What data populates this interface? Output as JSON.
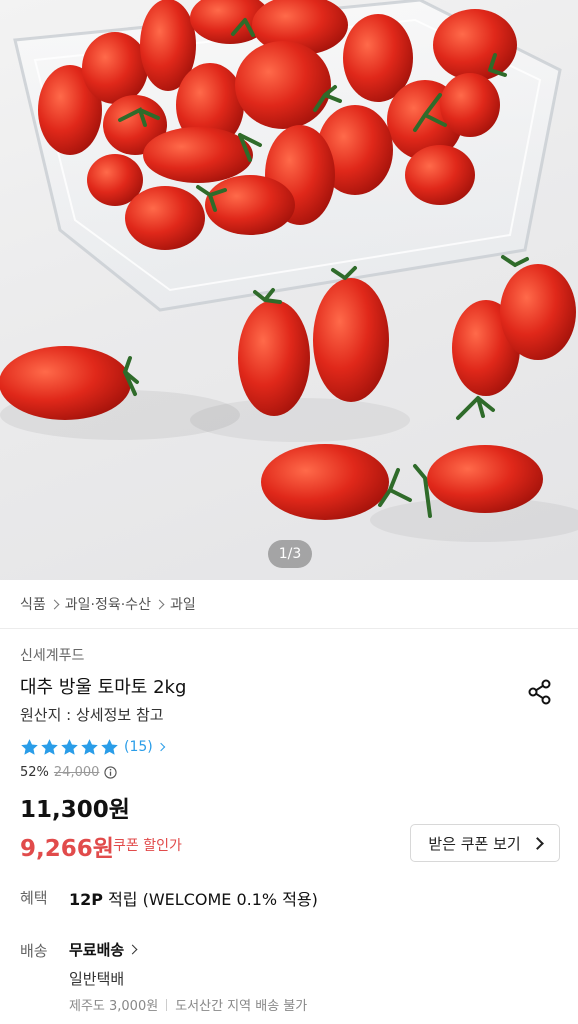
{
  "gallery": {
    "indicator": "1/3"
  },
  "breadcrumb": [
    "식품",
    "과일·정육·수산",
    "과일"
  ],
  "product": {
    "brand": "신세계푸드",
    "title": "대추 방울 토마토 2kg",
    "origin": "원산지 : 상세정보 참고",
    "rating": {
      "stars": 5,
      "review_count": "(15)"
    },
    "discount_rate": "52%",
    "original_price": "24,000",
    "sale_price": "11,300원",
    "coupon_price": "9,266원",
    "coupon_price_label": "쿠폰 할인가",
    "coupon_button_label": "받은 쿠폰 보기"
  },
  "benefit": {
    "label": "혜택",
    "points": "12P",
    "text": " 적립 (WELCOME 0.1% 적용)"
  },
  "delivery": {
    "label": "배송",
    "fee": "무료배송",
    "type": "일반택배",
    "jeju": "제주도 3,000원",
    "island": "도서산간 지역 배송 불가"
  },
  "colors": {
    "accent_red": "#e14b4b",
    "star_blue": "#2a9de8"
  },
  "icons": [
    "share-icon",
    "star-icon",
    "info-icon",
    "chevron-right-icon"
  ]
}
